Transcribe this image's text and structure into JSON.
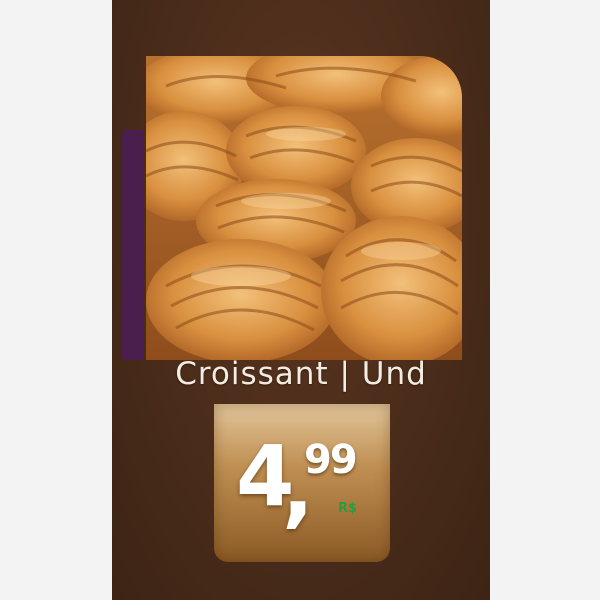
{
  "product": {
    "name": "Croissant  | Und",
    "image_icon": "croissant-photo"
  },
  "price": {
    "integer": "4",
    "separator": ",",
    "cents": "99",
    "currency": "R$"
  },
  "colors": {
    "background": "#4a2c1a",
    "accent_strip": "#4a1f4d",
    "price_box_top": "#e2c59a",
    "price_box_bottom": "#8c5a26",
    "currency_green": "#2f9a3c"
  }
}
